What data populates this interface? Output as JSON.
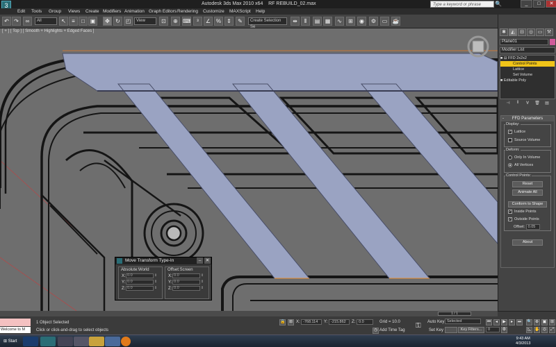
{
  "title": {
    "app": "Autodesk 3ds Max 2010 x64",
    "file": "RF REBUILD_02.max",
    "app_logo": "3",
    "search_placeholder": "Type a keyword or phrase"
  },
  "menu": [
    "Edit",
    "Tools",
    "Group",
    "Views",
    "Create",
    "Modifiers",
    "Animation",
    "Graph Editors",
    "Rendering",
    "Customize",
    "MAXScript",
    "Help"
  ],
  "toolbar": {
    "selection_filter": "All",
    "ref_coord": "View",
    "named_selection": "Create Selection Se",
    "icons": [
      "undo-icon",
      "redo-icon",
      "link-icon",
      "unlink-icon",
      "bind-space-warp-icon",
      "select-icon",
      "select-by-name-icon",
      "rect-select-icon",
      "window-crossing-icon",
      "move-icon",
      "rotate-icon",
      "scale-icon",
      "pivot-icon",
      "snap-icon",
      "angle-snap-icon",
      "percent-snap-icon",
      "spinner-snap-icon",
      "mirror-icon",
      "align-icon",
      "layer-icon",
      "curve-editor-icon",
      "schematic-icon",
      "material-editor-icon",
      "render-setup-icon",
      "render-frame-icon",
      "render-icon",
      "teapot-icon"
    ]
  },
  "viewport": {
    "label": "[ + ] [ Top ] [ Smooth + Highlights + Edged Faces ]"
  },
  "transform_typein": {
    "title": "Move Transform Type-In",
    "absolute_label": "Absolute:World",
    "offset_label": "Offset:Screen",
    "axes": [
      "X:",
      "Y:",
      "Z:"
    ],
    "absolute_values": [
      "0.0",
      "0.0",
      "0.0"
    ],
    "offset_values": [
      "0.0",
      "0.0",
      "0.0"
    ]
  },
  "command_panel": {
    "object_name": "Plane01",
    "modifier_list": "Modifier List",
    "object_color": "#d15a9a",
    "stack": [
      {
        "label": "FFD 2x2x2",
        "prefix": "■ ⊟"
      },
      {
        "label": "Control Points",
        "prefix": "",
        "selected": true
      },
      {
        "label": "Lattice",
        "prefix": ""
      },
      {
        "label": "Set Volume",
        "prefix": ""
      },
      {
        "label": "Editable Poly",
        "prefix": "■"
      }
    ],
    "rollout_title": "FFD Parameters",
    "rollout_toggle": "-",
    "display_label": "Display:",
    "lattice_label": "Lattice",
    "source_volume_label": "Source Volume",
    "deform_label": "Deform:",
    "only_in_volume": "Only In Volume",
    "all_vertices": "All Vertices",
    "control_points_label": "Control Points:",
    "reset_btn": "Reset",
    "animate_all_btn": "Animate All",
    "conform_btn": "Conform to Shape",
    "inside_points": "Inside Points",
    "outside_points": "Outside Points",
    "offset_label": "Offset:",
    "offset_value": "0.05",
    "about_btn": "About",
    "check_glyph": "✓"
  },
  "timeline": {
    "slider": "1 / 1"
  },
  "status": {
    "listener": "Welcome to M",
    "selected": "1 Object Selected",
    "prompt": "Click or click-and-drag to select objects",
    "x_label": "X:",
    "x_value": "-768.114",
    "y_label": "Y:",
    "y_value": "-215.862",
    "z_label": "Z:",
    "z_value": "0.0",
    "grid": "Grid = 10.0",
    "add_time_tag": "Add Time Tag",
    "auto_key": "Auto Key",
    "set_key": "Set Key",
    "key_mode": "Selected",
    "key_filters": "Key Filters...",
    "frame": "0"
  },
  "taskbar": {
    "start": "Start",
    "time": "9:43 AM",
    "date": "4/3/2013"
  }
}
